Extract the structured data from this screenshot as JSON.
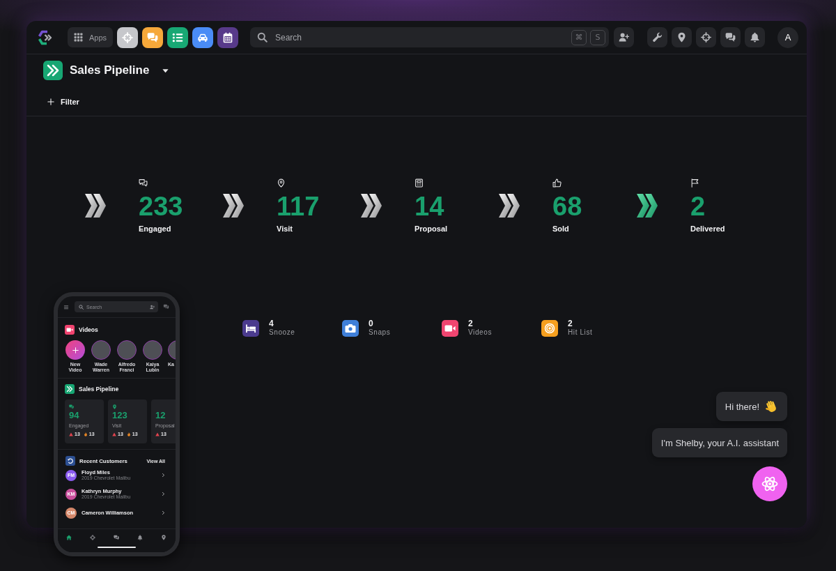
{
  "top_bar": {
    "apps_label": "Apps",
    "search": {
      "placeholder": "Search",
      "shortcut_keys": [
        "⌘",
        "S"
      ]
    },
    "avatar_initial": "A"
  },
  "header": {
    "title": "Sales Pipeline",
    "filter_label": "Filter"
  },
  "pipeline": [
    {
      "count": "233",
      "label": "Engaged",
      "active": false
    },
    {
      "count": "117",
      "label": "Visit",
      "active": false
    },
    {
      "count": "14",
      "label": "Proposal",
      "active": false
    },
    {
      "count": "68",
      "label": "Sold",
      "active": false
    },
    {
      "count": "2",
      "label": "Delivered",
      "active": true
    }
  ],
  "summary": [
    {
      "count": "4",
      "label": "Snooze",
      "color": "#4b3b8e"
    },
    {
      "count": "0",
      "label": "Snaps",
      "color": "#3f7fd8"
    },
    {
      "count": "2",
      "label": "Videos",
      "color": "#ef4570"
    },
    {
      "count": "2",
      "label": "Hit List",
      "color": "#f59f1f"
    }
  ],
  "assistant": {
    "messages": [
      {
        "text": "Hi there!",
        "kind": "wave"
      },
      {
        "text": "I'm Shelby, your A.I. assistant",
        "kind": "text"
      }
    ]
  },
  "phone": {
    "search_placeholder": "Search",
    "videos": {
      "title": "Videos",
      "items": [
        {
          "name": "New Video",
          "kind": "add"
        },
        {
          "name": "Wade Warren",
          "kind": "person"
        },
        {
          "name": "Alfredo Franci",
          "kind": "person"
        },
        {
          "name": "Kaiya Lubin",
          "kind": "person"
        },
        {
          "name": "Ka",
          "kind": "person"
        }
      ]
    },
    "pipeline": {
      "title": "Sales Pipeline",
      "cards": [
        {
          "count": "94",
          "label": "Engaged",
          "alerts": "13",
          "hot": "13"
        },
        {
          "count": "123",
          "label": "Visit",
          "alerts": "13",
          "hot": "13"
        },
        {
          "count": "12",
          "label": "Proposal",
          "alerts": "13"
        }
      ]
    },
    "customers": {
      "title": "Recent Customers",
      "link": "View All",
      "rows": [
        {
          "initials": "FM",
          "name": "Floyd Miles",
          "vehicle": "2019 Chevrolet Malibu",
          "color": "#8b5cf0"
        },
        {
          "initials": "KM",
          "name": "Kathryn Murphy",
          "vehicle": "2019 Chevrolet Malibu",
          "color": "#c94f9c"
        },
        {
          "initials": "CM",
          "name": "Cameron Williamson",
          "color": "#d4876a"
        }
      ]
    },
    "nav": [
      {
        "selected": true
      },
      {
        "selected": false
      },
      {
        "selected": false
      },
      {
        "selected": false
      },
      {
        "selected": false
      }
    ]
  }
}
